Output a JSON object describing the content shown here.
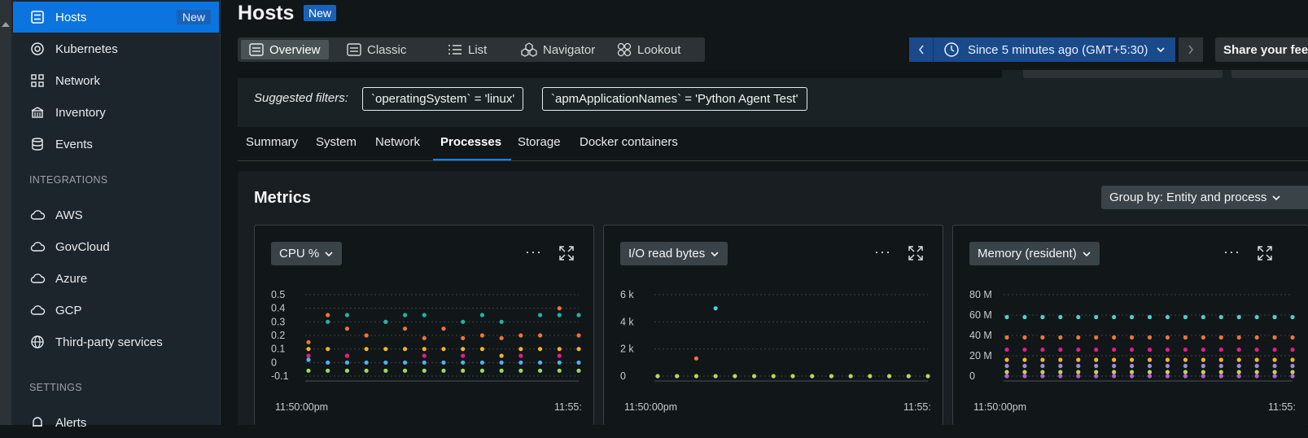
{
  "sidebar": {
    "items": [
      {
        "label": "Hosts",
        "icon": "hosts-icon",
        "badge": "New",
        "active": true
      },
      {
        "label": "Kubernetes",
        "icon": "kubernetes-icon"
      },
      {
        "label": "Network",
        "icon": "network-icon"
      },
      {
        "label": "Inventory",
        "icon": "inventory-icon"
      },
      {
        "label": "Events",
        "icon": "events-icon"
      }
    ],
    "integrations_heading": "INTEGRATIONS",
    "integrations": [
      {
        "label": "AWS",
        "icon": "cloud-icon"
      },
      {
        "label": "GovCloud",
        "icon": "cloud-icon"
      },
      {
        "label": "Azure",
        "icon": "cloud-icon"
      },
      {
        "label": "GCP",
        "icon": "cloud-icon"
      },
      {
        "label": "Third-party services",
        "icon": "globe-icon"
      }
    ],
    "settings_heading": "SETTINGS",
    "settings": [
      {
        "label": "Alerts",
        "icon": "bell-icon"
      }
    ]
  },
  "header": {
    "title": "Hosts",
    "badge": "New"
  },
  "view_tabs": [
    {
      "label": "Overview",
      "active": true
    },
    {
      "label": "Classic"
    },
    {
      "label": "List"
    },
    {
      "label": "Navigator"
    },
    {
      "label": "Lookout"
    }
  ],
  "time_picker": {
    "label": "Since 5 minutes ago (GMT+5:30)"
  },
  "share_button": "Share your feedback",
  "filters": {
    "label": "Suggested filters:",
    "chips": [
      "`operatingSystem` = 'linux'",
      "`apmApplicationNames` = 'Python Agent Test'"
    ]
  },
  "sub_tabs": [
    {
      "label": "Summary"
    },
    {
      "label": "System"
    },
    {
      "label": "Network"
    },
    {
      "label": "Processes",
      "active": true
    },
    {
      "label": "Storage"
    },
    {
      "label": "Docker containers"
    }
  ],
  "metrics": {
    "title": "Metrics",
    "group_by": "Group by: Entity and process"
  },
  "chart_data": [
    {
      "type": "scatter",
      "title": "CPU %",
      "y_ticks": [
        "0.5",
        "0.4",
        "0.3",
        "0.2",
        "0.1",
        "0",
        "-0.1"
      ],
      "ylim": [
        -0.1,
        0.5
      ],
      "x_ticks": [
        "11:50:00pm",
        "11:55:"
      ],
      "series": [
        {
          "color": "#f0733c",
          "values": [
            0.15,
            0.35,
            0.25,
            0.2,
            0.3,
            0.25,
            0.18,
            0.25,
            0.18,
            0.2,
            0.18,
            0.2,
            0.2,
            0.4,
            0.2
          ]
        },
        {
          "color": "#22b3a0",
          "values": [
            null,
            0.3,
            0.35,
            null,
            0.3,
            0.35,
            0.35,
            null,
            0.3,
            0.35,
            0.3,
            null,
            0.35,
            0.35,
            0.35
          ]
        },
        {
          "color": "#f5b32a",
          "values": [
            0.1,
            0.1,
            0.05,
            0.1,
            0.1,
            0.1,
            0.1,
            0.1,
            0.1,
            0.1,
            0.05,
            0.1,
            0.1,
            0.1,
            0.1
          ]
        },
        {
          "color": "#e51b8c",
          "values": [
            0.05,
            null,
            0.05,
            null,
            null,
            null,
            0.05,
            null,
            0.05,
            null,
            null,
            0.05,
            null,
            0.05,
            null
          ]
        },
        {
          "color": "#4fb3f0",
          "values": [
            0.02,
            0.0,
            0.0,
            0.0,
            0.0,
            0.0,
            0.0,
            0.0,
            0.0,
            0.0,
            0.0,
            0.0,
            0.0,
            0.0,
            0.0
          ]
        },
        {
          "color": "#a5d65c",
          "values": [
            -0.06,
            -0.06,
            -0.06,
            -0.06,
            -0.06,
            -0.06,
            -0.06,
            -0.06,
            -0.06,
            -0.06,
            -0.06,
            -0.06,
            -0.06,
            -0.06,
            -0.06
          ]
        }
      ]
    },
    {
      "type": "scatter",
      "title": "I/O read bytes",
      "y_ticks": [
        "6 k",
        "4 k",
        "2 k",
        "0"
      ],
      "ylim": [
        0,
        6000
      ],
      "x_ticks": [
        "11:50:00pm",
        "11:55:"
      ],
      "series": [
        {
          "color": "#4fd0e6",
          "values": [
            null,
            null,
            null,
            5000,
            null,
            null,
            null,
            null,
            null,
            null,
            null,
            null,
            null,
            null,
            null
          ]
        },
        {
          "color": "#f0733c",
          "values": [
            null,
            null,
            1300,
            null,
            null,
            null,
            null,
            null,
            null,
            null,
            null,
            null,
            null,
            null,
            null
          ]
        },
        {
          "color": "#b9d65c",
          "values": [
            0,
            0,
            0,
            0,
            0,
            0,
            0,
            0,
            0,
            0,
            0,
            0,
            0,
            0,
            0
          ]
        }
      ]
    },
    {
      "type": "scatter",
      "title": "Memory (resident)",
      "y_ticks": [
        "80 M",
        "60 M",
        "40 M",
        "20 M",
        "0"
      ],
      "ylim": [
        0,
        80000000
      ],
      "x_ticks": [
        "11:50:00pm",
        "11:55:"
      ],
      "series": [
        {
          "color": "#4fd0c6",
          "values": [
            58000000,
            58000000,
            58000000,
            58000000,
            58000000,
            58000000,
            58000000,
            58000000,
            58000000,
            58000000,
            58000000,
            58000000,
            58000000,
            58000000,
            58000000,
            58000000,
            58000000
          ]
        },
        {
          "color": "#f0733c",
          "values": [
            38000000,
            38000000,
            38000000,
            38000000,
            38000000,
            38000000,
            38000000,
            38000000,
            38000000,
            38000000,
            38000000,
            38000000,
            38000000,
            38000000,
            38000000,
            38000000,
            38000000
          ]
        },
        {
          "color": "#e51b8c",
          "values": [
            26000000,
            26000000,
            26000000,
            26000000,
            26000000,
            26000000,
            26000000,
            26000000,
            26000000,
            26000000,
            26000000,
            26000000,
            26000000,
            26000000,
            26000000,
            26000000,
            26000000
          ]
        },
        {
          "color": "#f5b32a",
          "values": [
            16000000,
            16000000,
            16000000,
            16000000,
            16000000,
            16000000,
            16000000,
            16000000,
            16000000,
            16000000,
            16000000,
            16000000,
            16000000,
            16000000,
            16000000,
            16000000,
            16000000
          ]
        },
        {
          "color": "#9a8fd6",
          "values": [
            10000000,
            10000000,
            10000000,
            10000000,
            10000000,
            10000000,
            10000000,
            10000000,
            10000000,
            10000000,
            10000000,
            10000000,
            10000000,
            10000000,
            10000000,
            10000000,
            10000000
          ]
        },
        {
          "color": "#b9d65c",
          "values": [
            4000000,
            4000000,
            4000000,
            4000000,
            4000000,
            4000000,
            4000000,
            4000000,
            4000000,
            4000000,
            4000000,
            4000000,
            4000000,
            4000000,
            4000000,
            4000000,
            4000000
          ]
        },
        {
          "color": "#c05ad0",
          "values": [
            0,
            0,
            0,
            0,
            0,
            0,
            0,
            0,
            0,
            0,
            0,
            0,
            0,
            0,
            0,
            0,
            0
          ]
        }
      ]
    }
  ]
}
